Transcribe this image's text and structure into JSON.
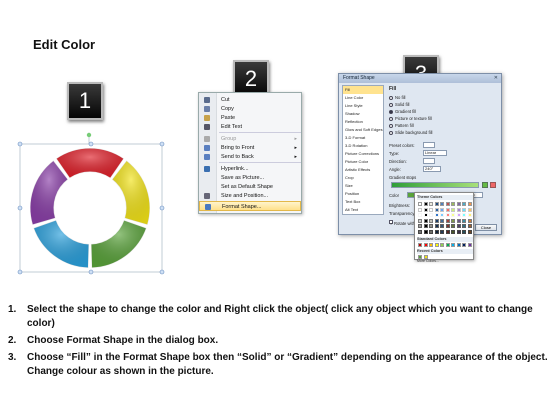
{
  "title": "Edit Color",
  "steps": [
    {
      "number": "1"
    },
    {
      "number": "2"
    },
    {
      "number": "3"
    }
  ],
  "context_menu": {
    "items": [
      {
        "label": "Cut",
        "icon": "scissors-icon",
        "color": "#5a6b8c"
      },
      {
        "label": "Copy",
        "icon": "copy-icon",
        "color": "#6b7fa8"
      },
      {
        "label": "Paste",
        "icon": "clipboard-icon",
        "color": "#c8a24a"
      },
      {
        "label": "Edit Text",
        "icon": "text-icon",
        "color": "#556"
      },
      {
        "label": "Group",
        "icon": "group-icon",
        "color": "#aaa",
        "disabled": true
      },
      {
        "label": "Bring to Front",
        "icon": "bring-front-icon",
        "color": "#5a7fc0"
      },
      {
        "label": "Send to Back",
        "icon": "send-back-icon",
        "color": "#5a7fc0"
      },
      {
        "label": "Hyperlink...",
        "icon": "hyperlink-icon",
        "color": "#3a6fb0"
      },
      {
        "label": "Save as Picture...",
        "icon": "",
        "color": ""
      },
      {
        "label": "Set as Default Shape",
        "icon": "",
        "color": ""
      },
      {
        "label": "Size and Position...",
        "icon": "resize-icon",
        "color": "#667"
      },
      {
        "label": "Format Shape...",
        "icon": "format-shape-icon",
        "color": "#4a7ac0",
        "selected": true
      }
    ]
  },
  "dialog": {
    "title": "Format Shape",
    "nav": [
      "Fill",
      "Line Color",
      "Line Style",
      "Shadow",
      "Reflection",
      "Glow and Soft Edges",
      "3-D Format",
      "3-D Rotation",
      "Picture Corrections",
      "Picture Color",
      "Artistic Effects",
      "Crop",
      "Size",
      "Position",
      "Text Box",
      "Alt Text"
    ],
    "section": "Fill",
    "options": [
      "No fill",
      "Solid fill",
      "Gradient fill",
      "Picture or texture fill",
      "Pattern fill",
      "Slide background fill"
    ],
    "preset_label": "Preset colors:",
    "type_label": "Type:",
    "type_value": "Linear",
    "direction_label": "Direction:",
    "angle_label": "Angle:",
    "angle_value": "240°",
    "stops_label": "Gradient stops",
    "color_label": "Color",
    "position_label": "Position:",
    "position_value": "0%",
    "brightness_label": "Brightness:",
    "transparency_label": "Transparency:",
    "rotate_label": "Rotate with shape",
    "close_label": "Close",
    "gradient_colors": [
      "#2f9e3a",
      "#a8e07a"
    ]
  },
  "palette": {
    "theme_label": "Theme Colors",
    "standard_label": "Standard Colors",
    "recent_label": "Recent Colors",
    "more_label": "More Colors...",
    "theme_colors": [
      "#ffffff",
      "#000000",
      "#eeece1",
      "#1f497d",
      "#4f81bd",
      "#c0504d",
      "#9bbb59",
      "#8064a2",
      "#4bacc6",
      "#f79646"
    ],
    "standard_colors": [
      "#c00000",
      "#ff0000",
      "#ffc000",
      "#ffff00",
      "#92d050",
      "#00b050",
      "#00b0f0",
      "#0070c0",
      "#002060",
      "#7030a0"
    ],
    "recent_colors": [
      "#5aa33b",
      "#f2e318"
    ]
  },
  "ring": {
    "segments": [
      {
        "name": "red",
        "color": "#e0202a"
      },
      {
        "name": "yellow",
        "color": "#f2e318"
      },
      {
        "name": "green",
        "color": "#5aa33b"
      },
      {
        "name": "blue",
        "color": "#2aa0dc"
      },
      {
        "name": "purple",
        "color": "#8a3fa8"
      }
    ]
  },
  "instructions": [
    {
      "num": "1.",
      "text": "Select the shape to change the color and Right click the object( click any object which you want to change color)"
    },
    {
      "num": "2.",
      "text": "Choose Format Shape in the dialog box."
    },
    {
      "num": "3.",
      "text": "Choose “Fill” in the Format Shape box then “Solid” or “Gradient” depending on the appearance of the object. Change colour as shown in the picture."
    }
  ]
}
